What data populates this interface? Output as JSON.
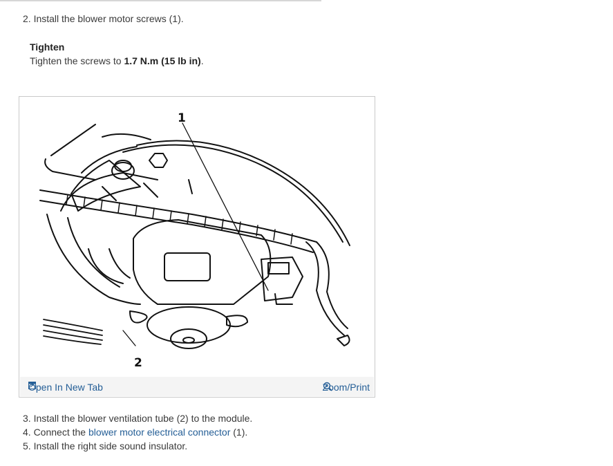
{
  "step2": "2. Install the blower motor screws (1).",
  "tighten": {
    "heading": "Tighten",
    "prefix": "Tighten the screws to ",
    "value": "1.7 N.m (15 lb in)",
    "suffix": "."
  },
  "figure": {
    "callout_1": "1",
    "callout_2": "2",
    "open_tab_label": "Open In New Tab",
    "zoom_label": "Zoom/Print",
    "open_tab_icon": "open-in-new-tab-icon",
    "zoom_icon": "zoom-in-icon",
    "link_color": "#245e96"
  },
  "steps": [
    {
      "text": "3. Install the blower ventilation tube (2) to the module."
    },
    {
      "prefix": "4. Connect the ",
      "link": "blower motor electrical connector",
      "suffix": " (1)."
    },
    {
      "text": "5. Install the right side sound insulator."
    }
  ]
}
